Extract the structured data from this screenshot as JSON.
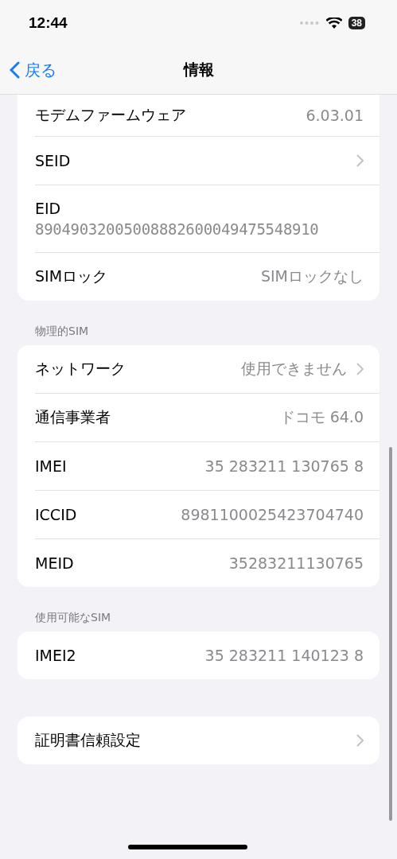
{
  "status_bar": {
    "time": "12:44",
    "battery": "38"
  },
  "nav": {
    "back": "戻る",
    "title": "情報"
  },
  "sections": [
    {
      "rows": [
        {
          "kind": "inline",
          "label": "モデムファームウェア",
          "value": "6.03.01",
          "chevron": false
        },
        {
          "kind": "inline",
          "label": "SEID",
          "chevron": true
        },
        {
          "kind": "stacked",
          "label": "EID",
          "value": "89049032005008882600049475548910",
          "chevron": false
        },
        {
          "kind": "inline",
          "label": "SIMロック",
          "value": "SIMロックなし",
          "chevron": false
        }
      ]
    },
    {
      "header": "物理的SIM",
      "rows": [
        {
          "kind": "inline",
          "label": "ネットワーク",
          "value": "使用できません",
          "chevron": true
        },
        {
          "kind": "inline",
          "label": "通信事業者",
          "value": "ドコモ 64.0",
          "chevron": false
        },
        {
          "kind": "inline",
          "label": "IMEI",
          "value": "35 283211 130765 8",
          "chevron": false
        },
        {
          "kind": "inline",
          "label": "ICCID",
          "value": "8981100025423704740",
          "chevron": false
        },
        {
          "kind": "inline",
          "label": "MEID",
          "value": "35283211130765",
          "chevron": false
        }
      ]
    },
    {
      "header": "使用可能なSIM",
      "rows": [
        {
          "kind": "inline",
          "label": "IMEI2",
          "value": "35 283211 140123 8",
          "chevron": false
        }
      ]
    },
    {
      "rows": [
        {
          "kind": "inline",
          "label": "証明書信頼設定",
          "chevron": true
        }
      ]
    }
  ]
}
